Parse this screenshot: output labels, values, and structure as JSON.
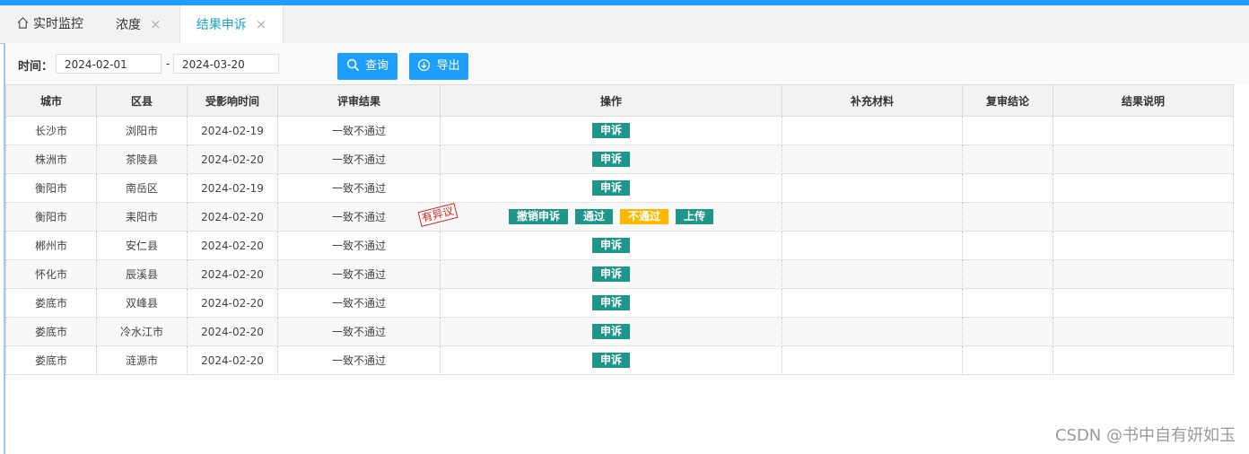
{
  "tabs": [
    {
      "label": "实时监控",
      "icon": "home-icon"
    },
    {
      "label": "浓度",
      "close": "×"
    },
    {
      "label": "结果申诉",
      "close": "×",
      "active": true
    }
  ],
  "filter": {
    "time_label": "时间：",
    "start_date": "2024-02-01",
    "separator": "-",
    "end_date": "2024-03-20",
    "query_label": "查询",
    "export_label": "导出"
  },
  "table": {
    "columns": [
      "城市",
      "区县",
      "受影响时间",
      "评审结果",
      "操作",
      "补充材料",
      "复审结论",
      "结果说明"
    ],
    "rows": [
      {
        "city": "长沙市",
        "county": "浏阳市",
        "date": "2024-02-19",
        "result": "一致不通过"
      },
      {
        "city": "株洲市",
        "county": "茶陵县",
        "date": "2024-02-20",
        "result": "一致不通过"
      },
      {
        "city": "衡阳市",
        "county": "南岳区",
        "date": "2024-02-19",
        "result": "一致不通过"
      },
      {
        "city": "衡阳市",
        "county": "耒阳市",
        "date": "2024-02-20",
        "result": "一致不通过"
      },
      {
        "city": "郴州市",
        "county": "安仁县",
        "date": "2024-02-20",
        "result": "一致不通过"
      },
      {
        "city": "怀化市",
        "county": "辰溪县",
        "date": "2024-02-20",
        "result": "一致不通过"
      },
      {
        "city": "娄底市",
        "county": "双峰县",
        "date": "2024-02-20",
        "result": "一致不通过"
      },
      {
        "city": "娄底市",
        "county": "冷水江市",
        "date": "2024-02-20",
        "result": "一致不通过"
      },
      {
        "city": "娄底市",
        "county": "涟源市",
        "date": "2024-02-20",
        "result": "一致不通过"
      }
    ],
    "appeal_label": "申诉",
    "dispute_stamp": "有异议",
    "row4_actions": [
      "撤销申诉",
      "通过",
      "不通过",
      "上传"
    ]
  },
  "watermark": "CSDN @书中自有妍如玉",
  "colors": {
    "accent": "#1e9fff",
    "teal": "#1e9689",
    "warning": "#ffb800",
    "stamp": "#e02020"
  }
}
